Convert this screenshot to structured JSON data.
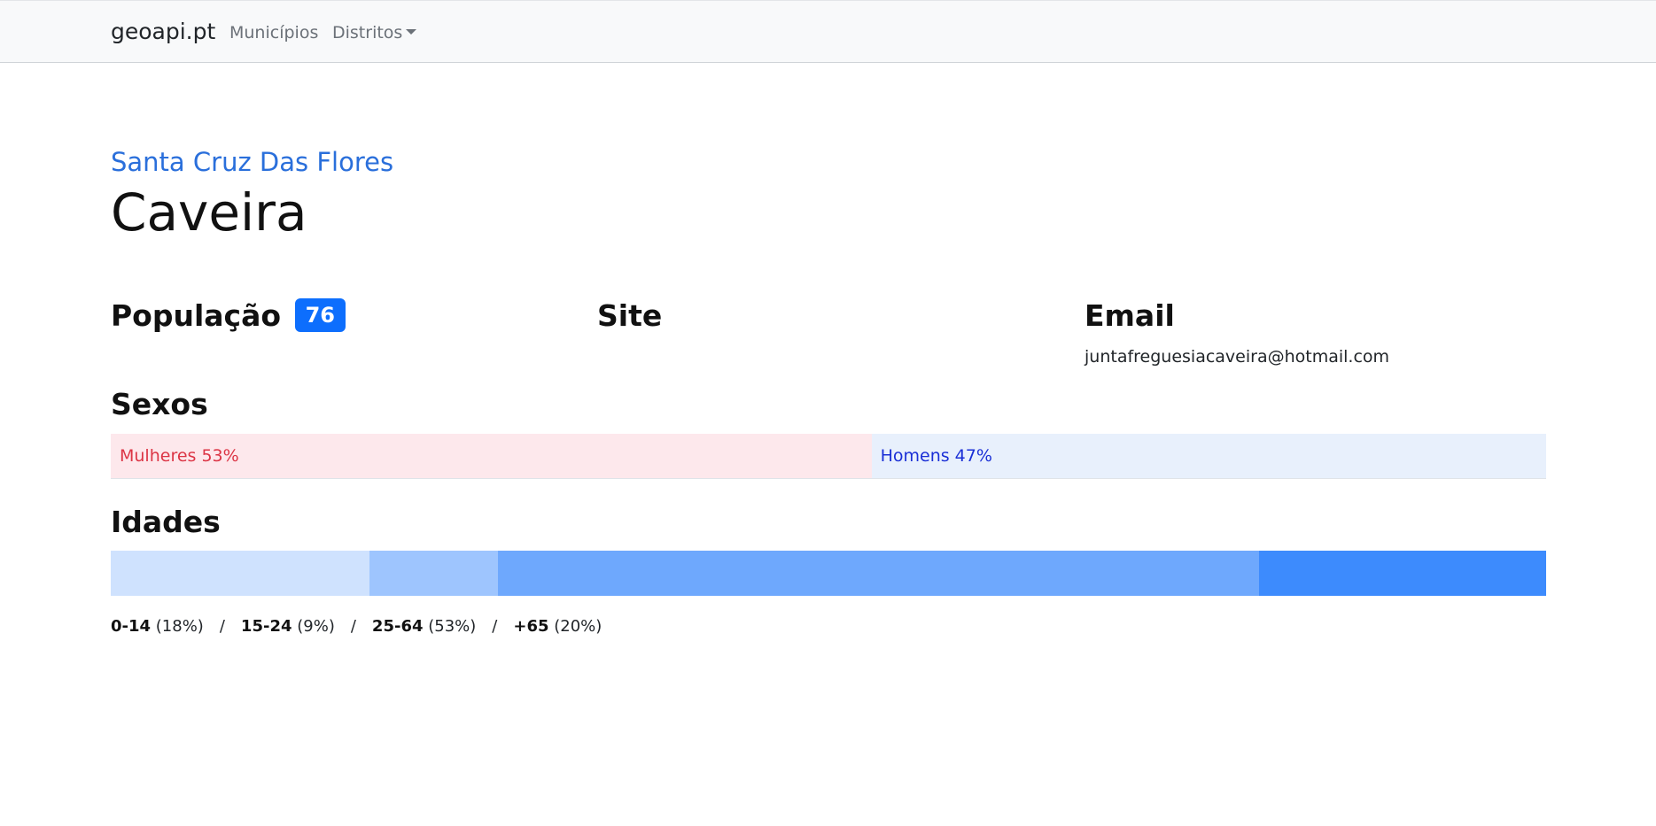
{
  "navbar": {
    "brand": "geoapi.pt",
    "links": [
      {
        "label": "Municípios"
      },
      {
        "label": "Distritos"
      }
    ]
  },
  "breadcrumb": {
    "municipio": "Santa Cruz Das Flores"
  },
  "page": {
    "title": "Caveira"
  },
  "info": {
    "populacao_label": "População",
    "populacao_value": "76",
    "site_label": "Site",
    "email_label": "Email",
    "email_value": "juntafreguesiacaveira@hotmail.com"
  },
  "sexos": {
    "title": "Sexos",
    "segments": [
      {
        "label": "Mulheres 53%",
        "percent": 53,
        "color": "#fde8ec",
        "text_color": "#dc3545"
      },
      {
        "label": "Homens 47%",
        "percent": 47,
        "color": "#e8f0fc",
        "text_color": "#1a2fd6"
      }
    ]
  },
  "idades": {
    "title": "Idades",
    "groups": [
      {
        "range": "0-14",
        "pct_text": "(18%)",
        "percent": 18,
        "color": "#cfe2fe"
      },
      {
        "range": "15-24",
        "pct_text": "(9%)",
        "percent": 9,
        "color": "#9ec5fe"
      },
      {
        "range": "25-64",
        "pct_text": "(53%)",
        "percent": 53,
        "color": "#6ea8fd"
      },
      {
        "range": "+65",
        "pct_text": "(20%)",
        "percent": 20,
        "color": "#3d8bfd"
      }
    ],
    "separator": "/"
  },
  "colors": {
    "accent": "#0d6efd",
    "link": "#2a6fdb",
    "navbar_bg": "#f8f9fa"
  }
}
